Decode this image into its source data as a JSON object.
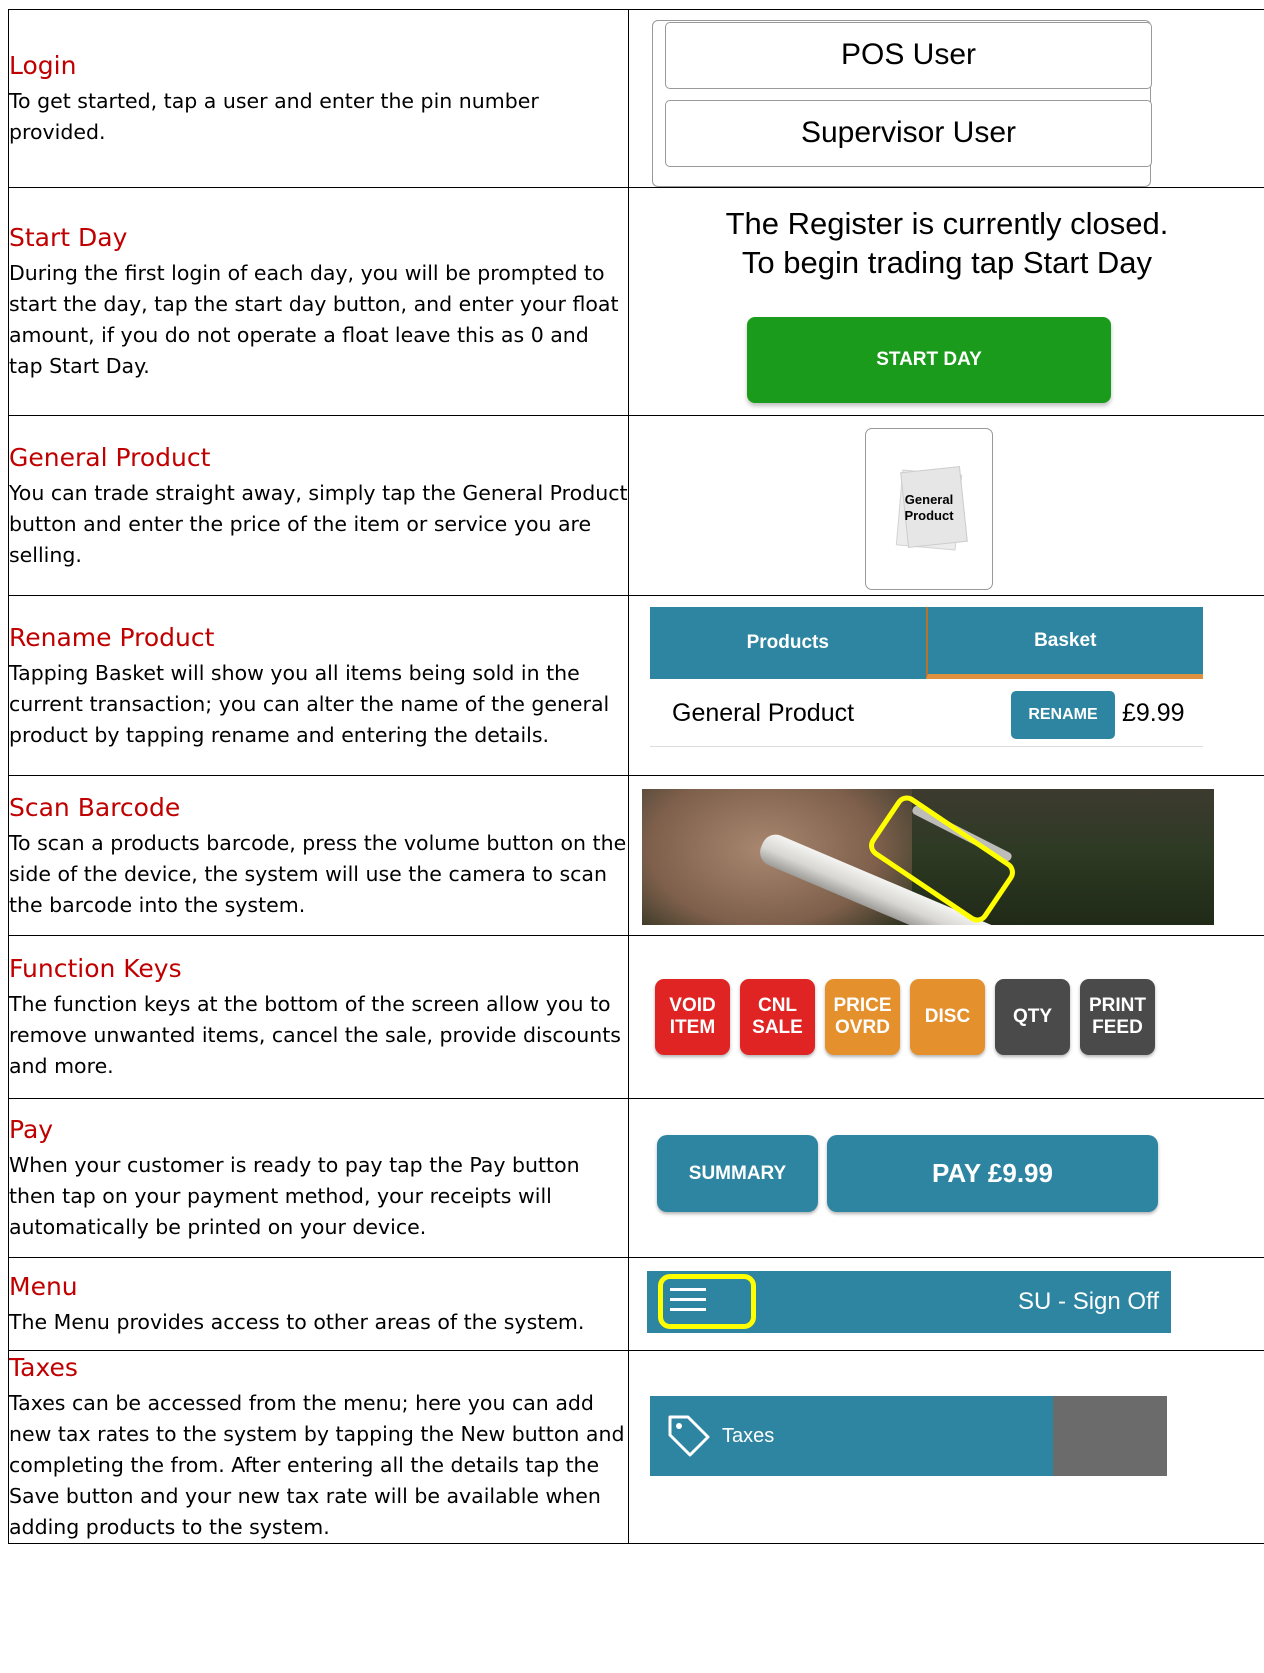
{
  "sections": [
    {
      "heading": "Login",
      "body": "To get started, tap a user and enter the pin number provided.",
      "users": [
        "POS User",
        "Supervisor User"
      ]
    },
    {
      "heading": "Start Day",
      "body": "During the first login of each day, you will be prompted to start the day, tap the start day button, and enter your float amount, if you do not operate a float leave this as 0 and tap Start Day.",
      "closed_line1": "The Register is currently closed.",
      "closed_line2": "To begin trading tap Start Day",
      "button": "START DAY"
    },
    {
      "heading": "General Product",
      "body": "You can trade straight away, simply tap the General Product button and enter the price of the item or service you are selling.",
      "tile_line1": "General",
      "tile_line2": "Product"
    },
    {
      "heading": "Rename Product",
      "body": "Tapping Basket will show you all items being sold in the current transaction; you can alter the name of the general product by tapping rename and entering the details.",
      "tab_products": "Products",
      "tab_basket": "Basket",
      "item_name": "General Product",
      "rename_button": "RENAME",
      "item_price": "£9.99"
    },
    {
      "heading": "Scan Barcode",
      "body": "To scan a products barcode, press the volume button on the side of the device, the system will use the camera to scan the barcode into the system."
    },
    {
      "heading": "Function Keys",
      "body": "The function keys at the bottom of the screen allow you to remove unwanted items, cancel the sale, provide discounts and more.",
      "keys": [
        {
          "label": "VOID\nITEM",
          "color": "#e02424"
        },
        {
          "label": "CNL\nSALE",
          "color": "#e02424"
        },
        {
          "label": "PRICE\nOVRD",
          "color": "#e3902d"
        },
        {
          "label": "DISC",
          "color": "#e3902d"
        },
        {
          "label": "QTY",
          "color": "#4a4a4a"
        },
        {
          "label": "PRINT\nFEED",
          "color": "#4a4a4a"
        }
      ]
    },
    {
      "heading": "Pay",
      "body": "When your customer is ready to pay tap the Pay button then tap on your payment method, your receipts will automatically be printed on your device.",
      "summary_button": "SUMMARY",
      "pay_button": "PAY £9.99"
    },
    {
      "heading": "Menu",
      "body": "The Menu provides access to other areas of the system.",
      "signoff": "SU - Sign Off"
    },
    {
      "heading": "Taxes",
      "body": "Taxes can be accessed from the menu; here you can add new tax rates to the system by tapping the New button and completing the from.  After entering all the details tap the Save button and your new tax rate will be available when adding products to the system.",
      "menu_item": "Taxes"
    }
  ],
  "colors": {
    "heading": "#c00000",
    "accent_blue": "#2e85a1",
    "start_green": "#1b9b1b",
    "highlight_yellow": "#ffff00"
  }
}
